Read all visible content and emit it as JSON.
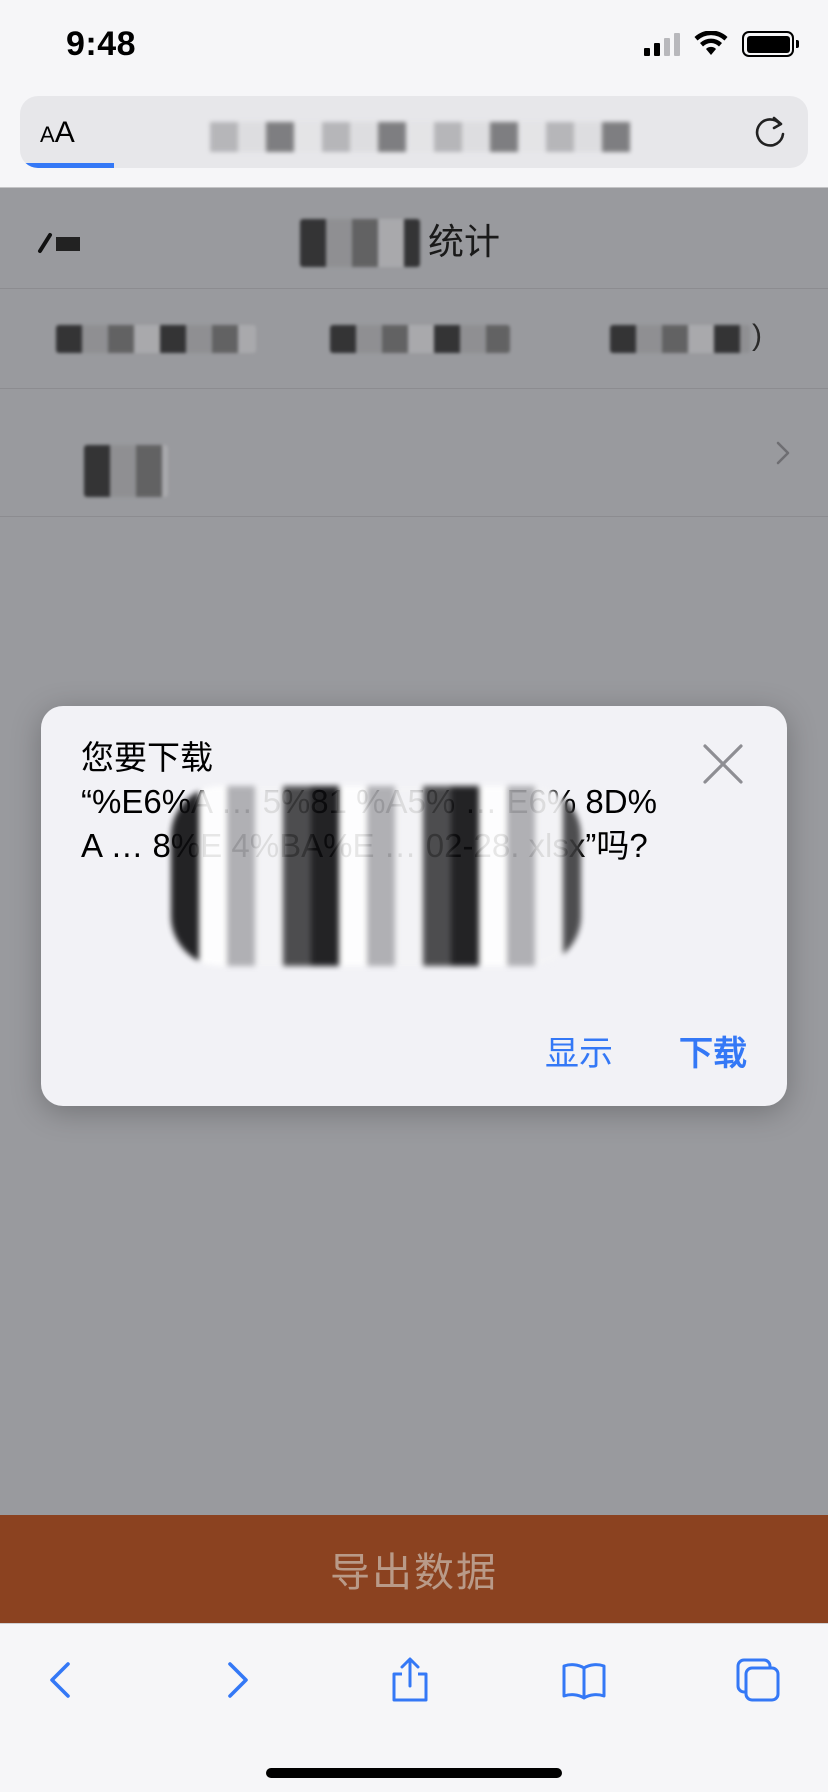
{
  "status_bar": {
    "time": "9:48"
  },
  "address_bar": {
    "aa_label_small": "A",
    "aa_label_large": "A"
  },
  "page": {
    "title": "统计",
    "row1_suffix": ")"
  },
  "dialog": {
    "prompt": "您要下载",
    "filename": "“%E6%A … 5%81 %A5% … E6% 8D%A … 8%E 4%BA%E … 02-28. xlsx”吗?",
    "actions": {
      "show": "显示",
      "download": "下载"
    }
  },
  "export_button": {
    "label": "导出数据"
  },
  "toolbar": {
    "icons": [
      "back-icon",
      "forward-icon",
      "share-icon",
      "bookmarks-icon",
      "tabs-icon"
    ]
  },
  "colors": {
    "accent": "#3478f6",
    "export_button_bg": "#8b4220",
    "dim_overlay": "#999a9e"
  }
}
